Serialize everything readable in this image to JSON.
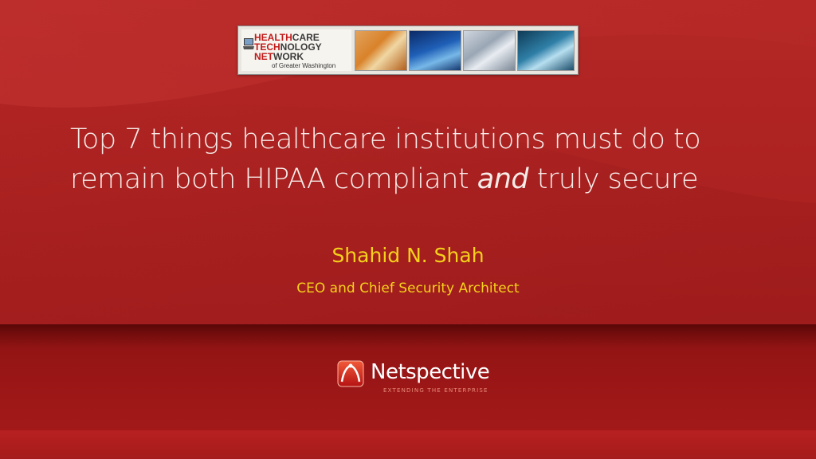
{
  "banner": {
    "logo_line1": {
      "red": "HEALTH",
      "gray": "CARE"
    },
    "logo_line2": {
      "red": "TECH",
      "gray": "NOLOGY"
    },
    "logo_line3": {
      "red": "NET",
      "gray": "WORK"
    },
    "logo_line4": "of Greater Washington",
    "photos": [
      "pill-bottles-photo",
      "monitor-photo",
      "keyboard-photo",
      "lab-worker-photo"
    ]
  },
  "title": {
    "line1": "Top 7 things healthcare institutions must do to",
    "line2_prefix": "remain both HIPAA compliant ",
    "line2_emphasis": "and",
    "line2_suffix": " truly secure"
  },
  "presenter": {
    "name": "Shahid N. Shah",
    "role": "CEO and Chief Security Architect"
  },
  "footer_logo": {
    "name": "Netspective",
    "tagline": "EXTENDING THE ENTERPRISE"
  },
  "colors": {
    "background": "#ad2322",
    "title_text": "#f7ece8",
    "presenter_text": "#f4d11a",
    "band": "#9a1616"
  }
}
